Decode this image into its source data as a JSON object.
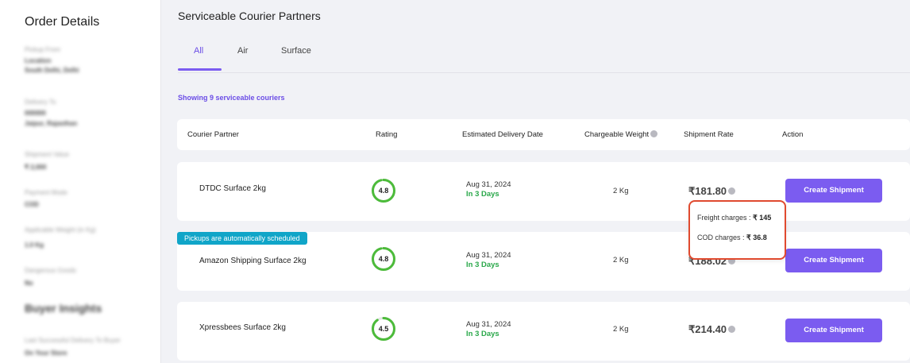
{
  "sidebar": {
    "title": "Order Details",
    "blurred_items": [
      {
        "label": "Pickup From",
        "values": [
          "Location",
          "South Delhi, Delhi"
        ]
      },
      {
        "label": "Delivery To",
        "values": [
          "000000",
          "Jaipur, Rajasthan"
        ]
      },
      {
        "label": "Shipment Value",
        "values": [
          "₹ 2,000"
        ]
      },
      {
        "label": "Payment Mode",
        "values": [
          "COD"
        ]
      },
      {
        "label": "Applicable Weight (in Kg)",
        "values": [
          "1.0 Kg"
        ]
      },
      {
        "label": "Dangerous Goods",
        "values": [
          "No"
        ]
      }
    ],
    "buyer_insights_heading": "Buyer Insights",
    "buyer_insights_label": "Last Successful Delivery To Buyer",
    "buyer_insights_value": "On Your Store"
  },
  "main": {
    "title": "Serviceable Courier Partners",
    "tabs": [
      {
        "label": "All",
        "active": true
      },
      {
        "label": "Air",
        "active": false
      },
      {
        "label": "Surface",
        "active": false
      }
    ],
    "showing_text": "Showing 9 serviceable couriers",
    "columns": [
      "Courier Partner",
      "Rating",
      "Estimated Delivery Date",
      "Chargeable Weight",
      "Shipment Rate",
      "Action"
    ],
    "rows": [
      {
        "courier": "DTDC Surface 2kg",
        "rating": "4.8",
        "rating_fraction": 0.96,
        "date": "Aug 31, 2024",
        "days": "In 3 Days",
        "weight": "2 Kg",
        "rate": "₹181.80",
        "action": "Create Shipment"
      },
      {
        "courier": "Amazon Shipping Surface 2kg",
        "rating": "4.8",
        "rating_fraction": 0.96,
        "date": "Aug 31, 2024",
        "days": "In 3 Days",
        "weight": "2 Kg",
        "rate": "₹188.02",
        "action": "Create Shipment",
        "badge": "Pickups are automatically scheduled"
      },
      {
        "courier": "Xpressbees Surface 2kg",
        "rating": "4.5",
        "rating_fraction": 0.9,
        "date": "Aug 31, 2024",
        "days": "In 3 Days",
        "weight": "2 Kg",
        "rate": "₹214.40",
        "action": "Create Shipment"
      }
    ],
    "tooltip": {
      "freight_label": "Freight charges :",
      "freight_value": "₹ 145",
      "cod_label": "COD charges :",
      "cod_value": "₹ 36.8"
    }
  },
  "colors": {
    "accent": "#7b5cf0",
    "rating_green": "#4cbb3a",
    "days_green": "#2aa84a",
    "badge": "#10a5c8",
    "tooltip_border": "#e04a2f"
  },
  "icons": {
    "info": "info-circle-icon"
  }
}
